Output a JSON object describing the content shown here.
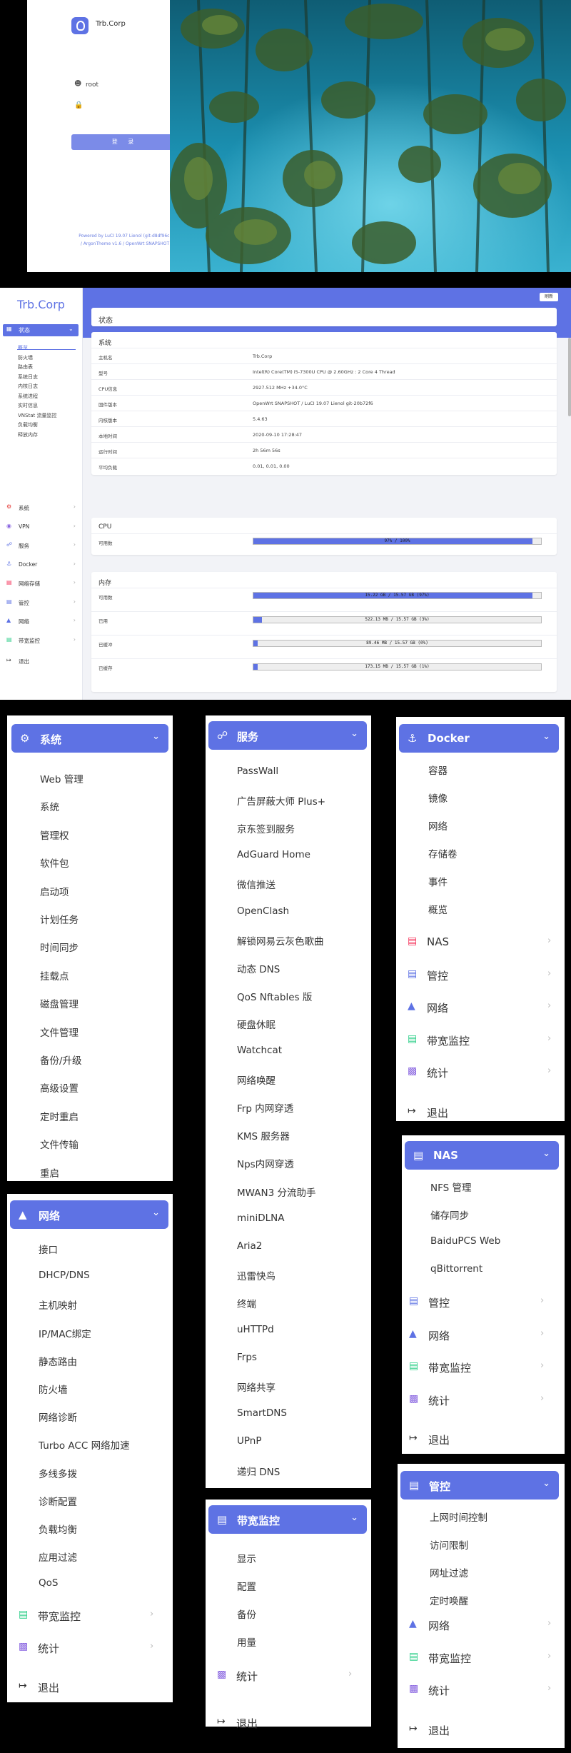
{
  "login": {
    "brand": "Trb.Corp",
    "username": "root",
    "login_button": "登 录",
    "footer_line1": "Powered by LuCI 19.07 Lienol (git-d8df96c)",
    "footer_line2": "/ ArgonTheme v1.6 / OpenWrt SNAPSHOT"
  },
  "status_page": {
    "brand": "Trb.Corp",
    "refresh": "刷新",
    "page_title": "状态",
    "sidebar": {
      "active": "状态",
      "sub_items": [
        "概览",
        "防火墙",
        "路由表",
        "系统日志",
        "内核日志",
        "系统进程",
        "实时信息",
        "VNStat 流量监控",
        "负载均衡",
        "释放内存"
      ],
      "nav_items": [
        {
          "label": "系统",
          "icon": "gear-icon"
        },
        {
          "label": "VPN",
          "icon": "vpn-icon"
        },
        {
          "label": "服务",
          "icon": "services-icon"
        },
        {
          "label": "Docker",
          "icon": "docker-icon"
        },
        {
          "label": "网络存储",
          "icon": "storage-icon"
        },
        {
          "label": "管控",
          "icon": "control-icon"
        },
        {
          "label": "网络",
          "icon": "network-icon"
        },
        {
          "label": "带宽监控",
          "icon": "bandwidth-icon"
        },
        {
          "label": "退出",
          "icon": "logout-icon"
        }
      ]
    },
    "system": {
      "title": "系统",
      "rows": [
        {
          "k": "主机名",
          "v": "Trb.Corp"
        },
        {
          "k": "型号",
          "v": "Intel(R) Core(TM) i5-7300U CPU @ 2.60GHz : 2 Core 4 Thread"
        },
        {
          "k": "CPU信息",
          "v": "2927.512 MHz +34.0°C"
        },
        {
          "k": "固件版本",
          "v": "OpenWrt SNAPSHOT / LuCI 19.07 Lienol git-20b72f6"
        },
        {
          "k": "内核版本",
          "v": "5.4.63"
        },
        {
          "k": "本地时间",
          "v": "2020-09-10 17:28:47"
        },
        {
          "k": "运行时间",
          "v": "2h 56m 56s"
        },
        {
          "k": "平均负载",
          "v": "0.01, 0.01, 0.00"
        }
      ]
    },
    "cpu": {
      "title": "CPU",
      "rows": [
        {
          "k": "可用数",
          "text": "97% / 100%",
          "fraction": 0.97
        }
      ]
    },
    "memory": {
      "title": "内存",
      "rows": [
        {
          "k": "可用数",
          "text": "15.22 GB / 15.57 GB (97%)",
          "fraction": 0.97
        },
        {
          "k": "已用",
          "text": "522.13 MB / 15.57 GB (3%)",
          "fraction": 0.03
        },
        {
          "k": "已缓冲",
          "text": "89.46 MB / 15.57 GB (0%)",
          "fraction": 0.0
        },
        {
          "k": "已缓存",
          "text": "173.15 MB / 15.57 GB (1%)",
          "fraction": 0.01
        }
      ]
    }
  },
  "menus": {
    "system": {
      "title": "系统",
      "items": [
        "Web 管理",
        "系统",
        "管理权",
        "软件包",
        "启动项",
        "计划任务",
        "时间同步",
        "挂载点",
        "磁盘管理",
        "文件管理",
        "备份/升级",
        "高级设置",
        "定时重启",
        "文件传输",
        "重启"
      ]
    },
    "network": {
      "title": "网络",
      "items": [
        "接口",
        "DHCP/DNS",
        "主机映射",
        "IP/MAC绑定",
        "静态路由",
        "防火墙",
        "网络诊断",
        "Turbo ACC 网络加速",
        "多线多拨",
        "诊断配置",
        "负载均衡",
        "应用过滤",
        "QoS"
      ],
      "nav": [
        "带宽监控",
        "统计",
        "退出"
      ]
    },
    "services": {
      "title": "服务",
      "items": [
        "PassWall",
        "广告屏蔽大师 Plus+",
        "京东签到服务",
        "AdGuard Home",
        "微信推送",
        "OpenClash",
        "解锁网易云灰色歌曲",
        "动态 DNS",
        "QoS Nftables 版",
        "硬盘休眠",
        "Watchcat",
        "网络唤醒",
        "Frp 内网穿透",
        "KMS 服务器",
        "Nps内网穿透",
        "MWAN3 分流助手",
        "miniDLNA",
        "Aria2",
        "迅雷快鸟",
        "终端",
        "uHTTPd",
        "Frps",
        "网络共享",
        "SmartDNS",
        "UPnP",
        "递归 DNS"
      ]
    },
    "bandwidth": {
      "title": "带宽监控",
      "items": [
        "显示",
        "配置",
        "备份",
        "用量"
      ],
      "nav": [
        "统计",
        "退出"
      ]
    },
    "docker": {
      "title": "Docker",
      "items": [
        "容器",
        "镜像",
        "网络",
        "存储卷",
        "事件",
        "概览"
      ],
      "nav": [
        "NAS",
        "管控",
        "网络",
        "带宽监控",
        "统计",
        "退出"
      ]
    },
    "nas": {
      "title": "NAS",
      "items": [
        "NFS 管理",
        "储存同步",
        "BaiduPCS Web",
        "qBittorrent"
      ],
      "nav": [
        "管控",
        "网络",
        "带宽监控",
        "统计",
        "退出"
      ]
    },
    "control": {
      "title": "管控",
      "items": [
        "上网时间控制",
        "访问限制",
        "网址过滤",
        "定时唤醒"
      ],
      "nav": [
        "网络",
        "带宽监控",
        "统计",
        "退出"
      ]
    }
  },
  "colors": {
    "accent": "#5e72e4",
    "bandwidth": "#2dce89",
    "stats": "#8965e0",
    "nas": "#f5365c",
    "logout": "#333333"
  }
}
